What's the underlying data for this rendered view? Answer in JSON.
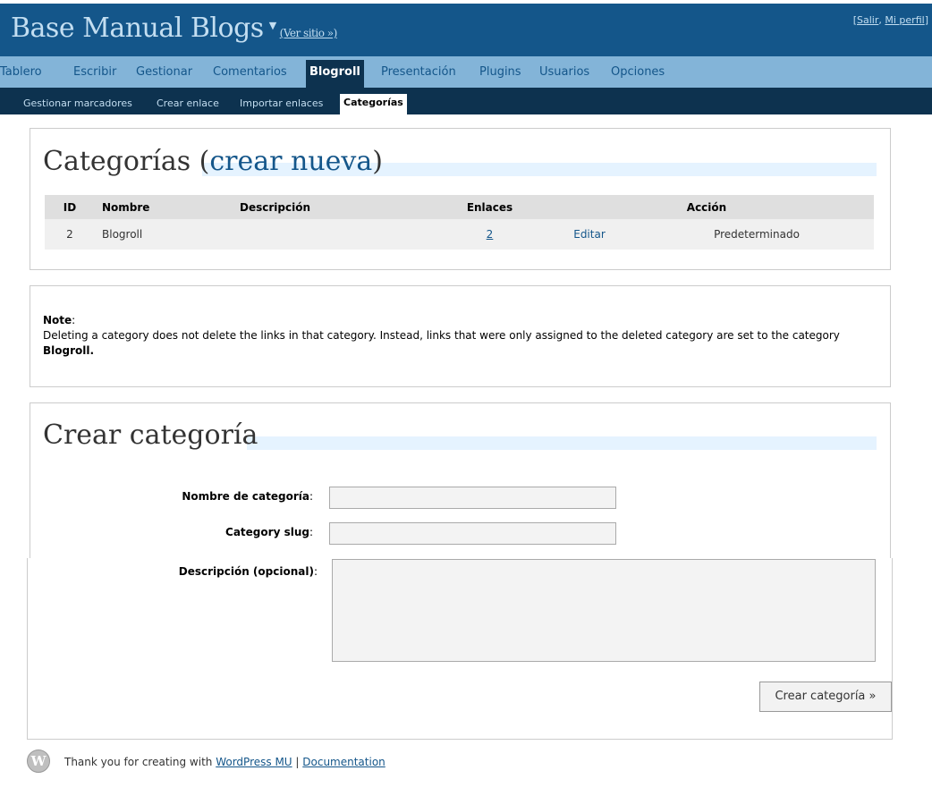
{
  "header": {
    "blog_title": "Base Manual Blogs",
    "view_site": "(Ver sitio »)",
    "bracket_open": "[",
    "logout": "Salir",
    "sep": ", ",
    "profile": "Mi perfil",
    "bracket_close": "]"
  },
  "menu": {
    "items": [
      "Tablero",
      "Escribir",
      "Gestionar",
      "Comentarios",
      "Blogroll",
      "Presentación",
      "Plugins",
      "Usuarios",
      "Opciones"
    ],
    "current": "Blogroll"
  },
  "submenu": {
    "items": [
      "Gestionar marcadores",
      "Crear enlace",
      "Importar enlaces",
      "Categorías"
    ],
    "current": "Categorías"
  },
  "categories": {
    "title_prefix": "Categorías (",
    "title_link": "crear nueva",
    "title_suffix": ")",
    "columns": [
      "ID",
      "Nombre",
      "Descripción",
      "Enlaces",
      "Acción"
    ],
    "rows": [
      {
        "id": "2",
        "name": "Blogroll",
        "description": "",
        "links": "2",
        "edit": "Editar",
        "default": "Predeterminado"
      }
    ]
  },
  "note": {
    "label": "Note",
    "colon": ":",
    "text": "Deleting a category does not delete the links in that category. Instead, links that were only assigned to the deleted category are set to the category ",
    "bold": "Blogroll."
  },
  "create": {
    "title": "Crear categoría",
    "name_label": "Nombre de categoría",
    "slug_label": "Category slug",
    "desc_label": "Descripción (opcional)",
    "colon": ":",
    "name_value": "",
    "slug_value": "",
    "desc_value": "",
    "submit": "Crear categoría »"
  },
  "footer": {
    "text": "Thank you for creating with ",
    "wpmu_link": "WordPress MU",
    "sep": " | ",
    "doc_link": "Documentation"
  },
  "colors": {
    "header_bg": "#14568a",
    "menu_bg": "#83b4d8",
    "submenu_bg": "#0d324f",
    "link": "#14568a",
    "heading_underline": "#e5f3ff"
  },
  "icons": {
    "menu_caret": "caret-down-icon",
    "footer_logo": "wordpress-logo-icon"
  }
}
